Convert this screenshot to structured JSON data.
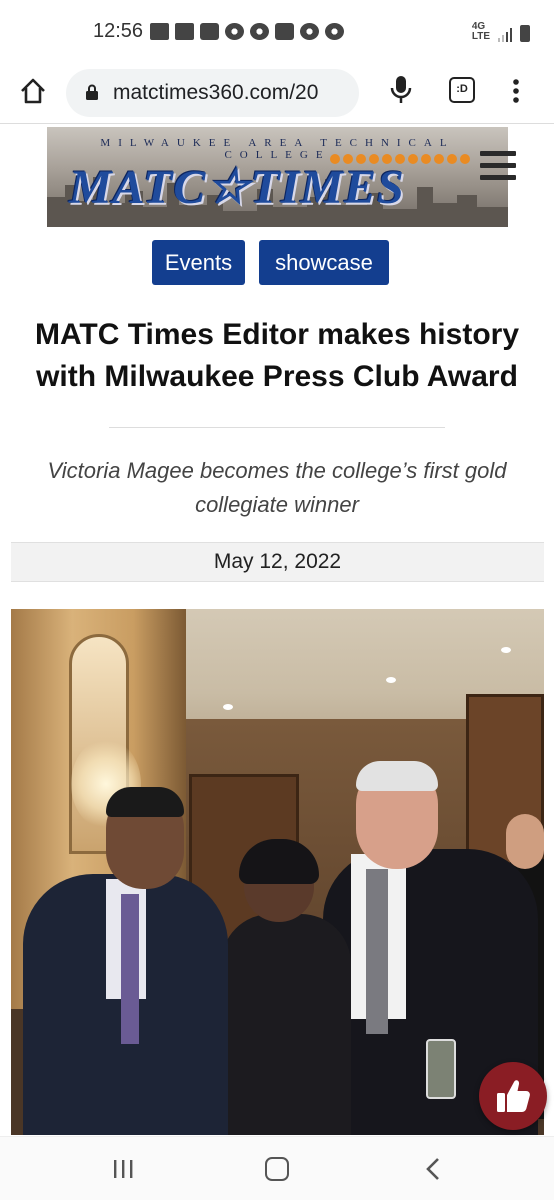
{
  "status_bar": {
    "time": "12:56",
    "network": "4G LTE",
    "notification_icons": [
      "mail-icon",
      "mail-icon",
      "trophy-icon",
      "pokeball-icon",
      "pokeball-icon",
      "trophy-icon",
      "pokeball-icon",
      "sync-icon"
    ]
  },
  "browser": {
    "url": "matctimes360.com/20",
    "tabs_label": ":D"
  },
  "site": {
    "banner_subtitle": "MILWAUKEE AREA TECHNICAL COLLEGE",
    "banner_title": "MATC☆TIMES",
    "brand_color": "#133e8f",
    "accent_color": "#e98b23"
  },
  "article": {
    "categories": [
      "Events",
      "showcase"
    ],
    "title": "MATC Times Editor makes history with Milwaukee Press Club Award",
    "subtitle": "Victoria Magee becomes the college’s first gold collegiate winner",
    "date": "May 12, 2022"
  },
  "like_button": {
    "icon": "thumbs-up-icon",
    "color": "#8a1d24"
  },
  "nav_bar": {
    "icons": [
      "recents-icon",
      "home-icon",
      "back-icon"
    ]
  }
}
